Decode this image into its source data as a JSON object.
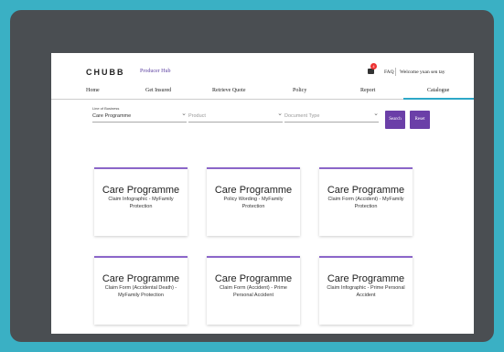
{
  "header": {
    "logo": "CHUBB",
    "portal_name": "Producer Hub",
    "cart_count": "4",
    "faq": "FAQ",
    "welcome": "Welcome yuan sen tay"
  },
  "nav": {
    "items": [
      {
        "label": "Home"
      },
      {
        "label": "Get Insured"
      },
      {
        "label": "Retrieve Quote"
      },
      {
        "label": "Policy"
      },
      {
        "label": "Report"
      },
      {
        "label": "Catalogue"
      }
    ],
    "active": "Catalogue"
  },
  "filters": {
    "line_of_business_label": "Line of Business",
    "line_of_business_value": "Care Programme",
    "product_placeholder": "Product",
    "document_type_placeholder": "Document Type",
    "search_label": "Search",
    "reset_label": "Reset"
  },
  "cards": [
    {
      "title": "Care Programme",
      "subtitle": "Claim Infographic - MyFamily Protection"
    },
    {
      "title": "Care Programme",
      "subtitle": "Policy Wording - MyFamily Protection"
    },
    {
      "title": "Care Programme",
      "subtitle": "Claim Form (Accident) - MyFamily Protection"
    },
    {
      "title": "Care Programme",
      "subtitle": "Claim Form (Accidental Death) - MyFamily Protection"
    },
    {
      "title": "Care Programme",
      "subtitle": "Claim Form (Accident) - Prime Personal Accident"
    },
    {
      "title": "Care Programme",
      "subtitle": "Claim Infographic - Prime Personal Accident"
    }
  ],
  "colors": {
    "background": "#3ab0c4",
    "frame": "#4a4e52",
    "accent": "#6b3fa8",
    "card_border": "#8b66c9",
    "active_tab": "#2da8c8"
  }
}
